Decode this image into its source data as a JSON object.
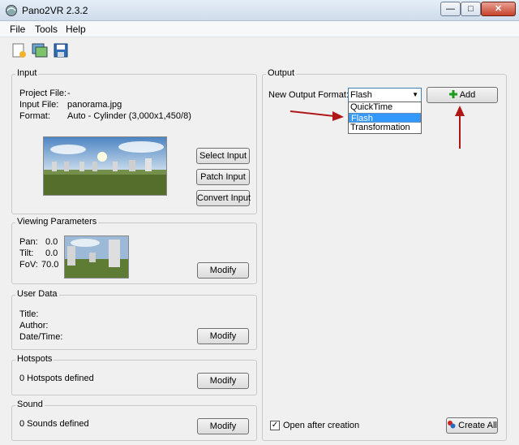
{
  "window": {
    "title": "Pano2VR 2.3.2",
    "min": "—",
    "max": "□",
    "close": "✕"
  },
  "menu": [
    "File",
    "Tools",
    "Help"
  ],
  "toolbar": {
    "icons": [
      "new-project-icon",
      "open-project-icon",
      "save-project-icon"
    ]
  },
  "input": {
    "title": "Input",
    "project_file_label": "Project File:",
    "project_file_value": "-",
    "input_file_label": "Input File:",
    "input_file_value": "panorama.jpg",
    "format_label": "Format:",
    "format_value": "Auto - Cylinder (3,000x1,450/8)",
    "select_button": "Select Input",
    "patch_button": "Patch Input",
    "convert_button": "Convert Input"
  },
  "viewing": {
    "title": "Viewing Parameters",
    "pan_label": "Pan:",
    "pan_value": "0.0",
    "tilt_label": "Tilt:",
    "tilt_value": "0.0",
    "fov_label": "FoV:",
    "fov_value": "70.0",
    "modify_button": "Modify"
  },
  "user_data": {
    "title": "User Data",
    "title_label": "Title:",
    "author_label": "Author:",
    "datetime_label": "Date/Time:",
    "modify_button": "Modify"
  },
  "hotspots": {
    "title": "Hotspots",
    "status": "0 Hotspots defined",
    "modify_button": "Modify"
  },
  "sound": {
    "title": "Sound",
    "status": "0 Sounds defined",
    "modify_button": "Modify"
  },
  "output": {
    "title": "Output",
    "format_label": "New Output Format:",
    "format_selected": "Flash",
    "format_options": [
      "QuickTime",
      "Flash",
      "Transformation"
    ],
    "add_button": "Add",
    "open_after_label": "Open after creation",
    "open_after_checked": true,
    "create_all_button": "Create All"
  },
  "colors": {
    "arrow_annotation": "#b01818",
    "selected_option": "#3399ff"
  }
}
